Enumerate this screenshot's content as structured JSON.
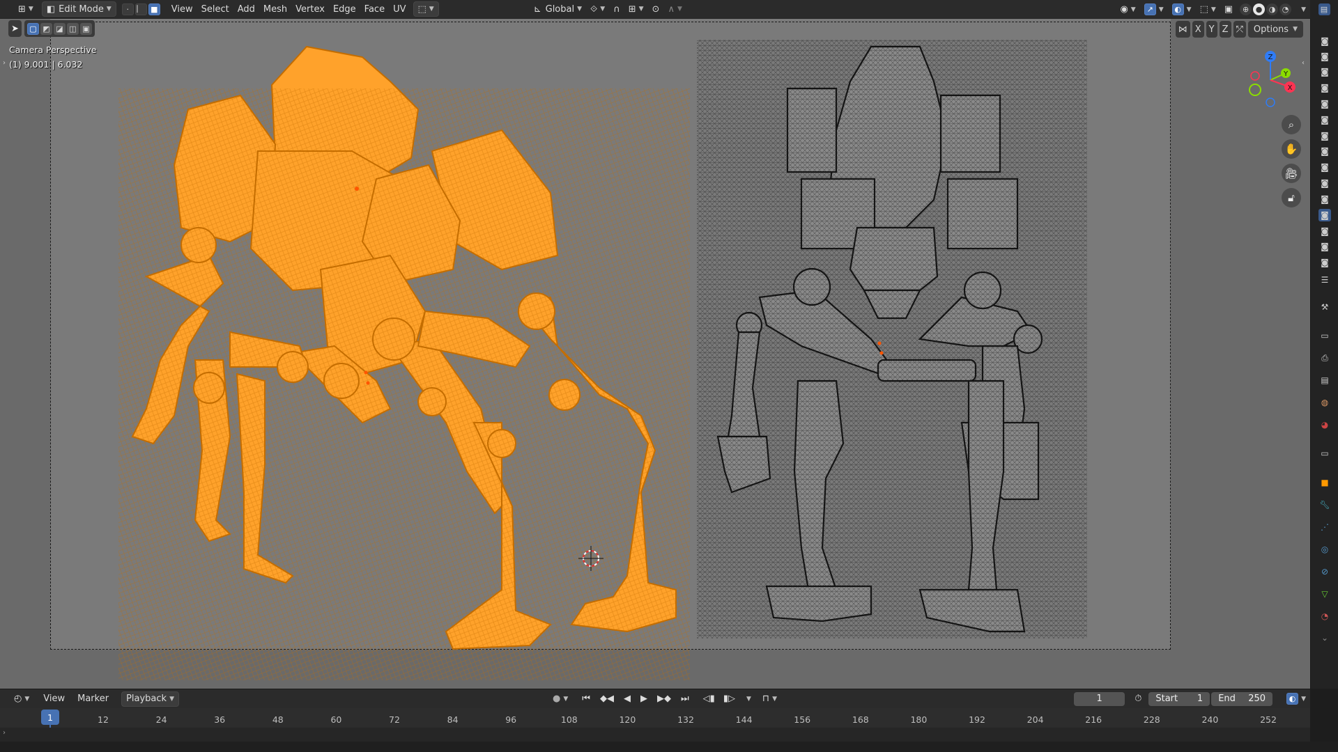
{
  "topbar": {
    "mode": "Edit Mode",
    "menus": [
      "View",
      "Select",
      "Add",
      "Mesh",
      "Vertex",
      "Edge",
      "Face",
      "UV"
    ],
    "transform_orientation": "Global"
  },
  "viewport": {
    "camera_label": "Camera Perspective",
    "selection_info": "(1) 9.001 | 6.032",
    "options_label": "Options",
    "axes": [
      "X",
      "Y",
      "Z"
    ],
    "gizmo_labels": {
      "z": "Z",
      "y": "Y",
      "x": "X"
    }
  },
  "timeline": {
    "menus": [
      "View",
      "Marker"
    ],
    "playback_label": "Playback",
    "current_frame": "1",
    "start_label": "Start",
    "start_value": "1",
    "end_label": "End",
    "end_value": "250",
    "ruler_current": "1",
    "ruler_marks": [
      "12",
      "24",
      "36",
      "48",
      "60",
      "72",
      "84",
      "96",
      "108",
      "120",
      "132",
      "144",
      "156",
      "168",
      "180",
      "192",
      "204",
      "216",
      "228",
      "240",
      "252"
    ]
  },
  "colors": {
    "selected_mesh": "#ff9a1f",
    "wire_mesh": "#1a1a1a",
    "accent": "#4772b3",
    "viewport_bg": "#7a7a7a"
  }
}
